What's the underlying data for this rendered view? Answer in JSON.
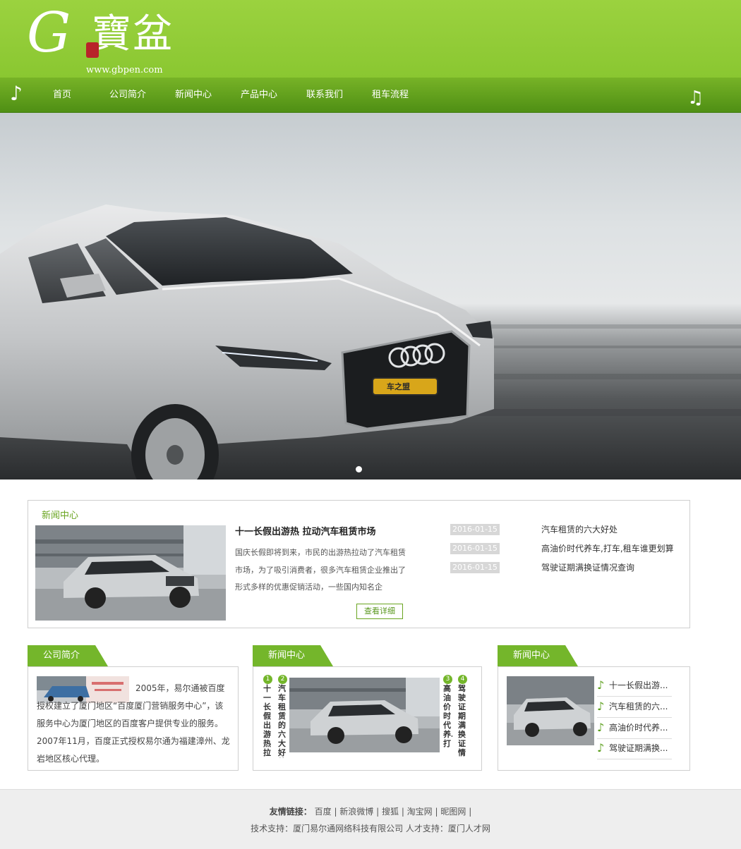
{
  "logo": {
    "letter": "G",
    "chinese": "寶盆",
    "seal_text": "G寶盆",
    "url_text": "www.gbpen.com"
  },
  "nav": {
    "items": [
      {
        "label": "首页"
      },
      {
        "label": "公司简介"
      },
      {
        "label": "新闻中心"
      },
      {
        "label": "产品中心"
      },
      {
        "label": "联系我们"
      },
      {
        "label": "租车流程"
      }
    ]
  },
  "banner": {
    "plate_text": "车之盟",
    "slide_count": 1,
    "active_slide": 1
  },
  "news_panel": {
    "title": "新闻中心",
    "headline": "十一长假出游热 拉动汽车租赁市场",
    "summary": "国庆长假即将到来，市民的出游热拉动了汽车租赁市场，为了吸引消费者，很多汽车租赁企业推出了形式多样的优惠促销活动，一些国内知名企",
    "more_button": "查看详细",
    "list": [
      {
        "date": "2016-01-15",
        "title": "汽车租赁的六大好处"
      },
      {
        "date": "2016-01-15",
        "title": "高油价时代养车,打车,租车谁更划算"
      },
      {
        "date": "2016-01-15",
        "title": "驾驶证期满换证情况查询"
      }
    ]
  },
  "about_box": {
    "title": "公司简介",
    "text": "2005年，易尔通被百度授权建立了厦门地区“百度厦门营销服务中心”，该服务中心为厦门地区的百度客户提供专业的服务。2007年11月，百度正式授权易尔通为福建漳州、龙岩地区核心代理。"
  },
  "news_box_middle": {
    "title": "新闻中心",
    "vertical_items": [
      {
        "num": "1",
        "text": "十一长假出游热拉"
      },
      {
        "num": "2",
        "text": "汽车租赁的六大好处"
      },
      {
        "num": "3",
        "text": "高油价时代养…打"
      },
      {
        "num": "4",
        "text": "驾驶证期满换证情"
      }
    ]
  },
  "news_box_right": {
    "title": "新闻中心",
    "items": [
      {
        "text": "十一长假出游..."
      },
      {
        "text": "汽车租赁的六..."
      },
      {
        "text": "高油价时代养..."
      },
      {
        "text": "驾驶证期满换..."
      }
    ]
  },
  "footer": {
    "links_label": "友情链接：",
    "links": [
      "百度",
      "新浪微博",
      "搜狐",
      "淘宝网",
      "昵图网"
    ],
    "tech_support": "技术支持：厦门易尔通网络科技有限公司 人才支持：厦门人才网"
  },
  "colors": {
    "brand_green": "#8ac731",
    "nav_green": "#5b9c1c",
    "accent_green": "#74b62b"
  }
}
